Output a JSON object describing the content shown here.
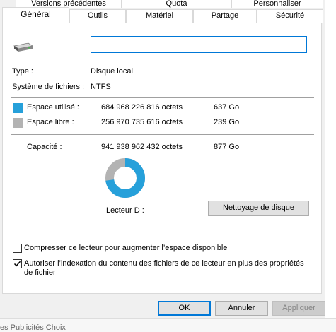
{
  "dialog": {
    "tabs_row1": [
      {
        "label": "Versions précédentes"
      },
      {
        "label": "Quota"
      },
      {
        "label": "Personnaliser"
      }
    ],
    "tabs_row2": [
      {
        "label": "Général",
        "active": true
      },
      {
        "label": "Outils"
      },
      {
        "label": "Matériel"
      },
      {
        "label": "Partage"
      },
      {
        "label": "Sécurité"
      }
    ]
  },
  "general": {
    "drive_icon": "drive-icon",
    "volume_name_value": "",
    "type_label": "Type :",
    "type_value": "Disque local",
    "fs_label": "Système de fichiers :",
    "fs_value": "NTFS",
    "used": {
      "label": "Espace utilisé :",
      "bytes": "684 968 226 816 octets",
      "size": "637 Go",
      "color": "#26a0da"
    },
    "free": {
      "label": "Espace libre :",
      "bytes": "256 970 735 616 octets",
      "size": "239 Go",
      "color": "#b3b3b3"
    },
    "capacity": {
      "label": "Capacité :",
      "bytes": "941 938 962 432 octets",
      "size": "877 Go"
    },
    "used_fraction": 0.727,
    "drive_label": "Lecteur D :",
    "cleanup_button": "Nettoyage de disque",
    "compress_label": "Compresser ce lecteur pour augmenter l’espace disponible",
    "compress_checked": false,
    "index_label": "Autoriser l’indexation du contenu des fichiers de ce lecteur en plus des propriétés de fichier",
    "index_checked": true
  },
  "buttons": {
    "ok": "OK",
    "cancel": "Annuler",
    "apply": "Appliquer"
  },
  "background": {
    "bottom_text": "es   Publicités   Choix"
  }
}
